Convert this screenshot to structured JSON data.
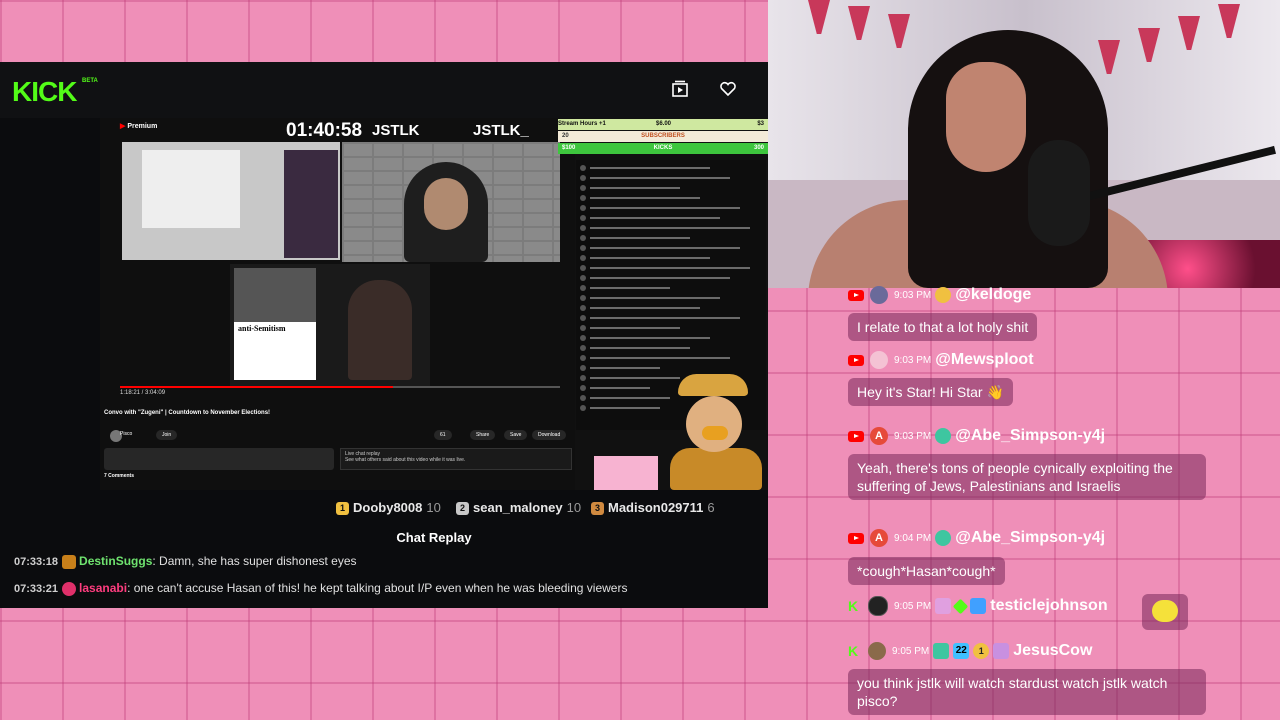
{
  "kick": {
    "logo": "KICK",
    "beta": "BETA",
    "theater_icon": "theater-mode-icon",
    "follow_icon": "heart-icon"
  },
  "embedded_video": {
    "yt_logo": "Premium",
    "timer": "01:40:58",
    "tag1": "JSTLK",
    "tag2": "JSTLK_",
    "anti_title": "anti-Semitism",
    "controls_time": "1:18:21 / 3:04:09",
    "title": "Convo with \"Zugeni\" | Countdown to November Elections!",
    "channel_name": "Pisco",
    "pills": [
      "Join",
      "61",
      "Share",
      "Save",
      "Download"
    ],
    "live_chat": "Live chat replay",
    "live_chat_sub": "See what others said about this video while it was live.",
    "comments": "7 Comments",
    "stat_stream_hours": "Stream Hours",
    "stat_plus": "+1",
    "stat_money": "$6.00",
    "stat_subs": "SUBSCRIBERS",
    "stat_kicks": "KICKS",
    "stat_left": "$100",
    "stat_right": "300",
    "stat_20": "20",
    "stat_30": "$3"
  },
  "leaderboard": [
    {
      "rank": "1",
      "name": "Dooby8008",
      "count": "10",
      "color": "#f0c040"
    },
    {
      "rank": "2",
      "name": "sean_maloney",
      "count": "10",
      "color": "#c8c8c8"
    },
    {
      "rank": "3",
      "name": "Madison029711",
      "count": "6",
      "color": "#d08a40"
    }
  ],
  "chat_replay": {
    "title": "Chat Replay",
    "messages": [
      {
        "time": "07:33:18",
        "user": "DestinSuggs",
        "user_color": "#6fe36f",
        "text": ": Damn, she has super dishonest eyes",
        "badge_color": "#c8801a"
      },
      {
        "time": "07:33:21",
        "user": "lasanabi",
        "user_color": "#ff3d7f",
        "text": ": one can't accuse Hasan of this! he kept talking about I/P even when he was bleeding viewers",
        "badge_color": "#e0306a"
      }
    ]
  },
  "right_chat": {
    "messages": [
      {
        "platform": "youtube",
        "time": "9:03 PM",
        "user": "@keldoge",
        "text": "I relate to that a lot holy shit",
        "avatar_color": "#6a6a9a",
        "avatar_letter": ""
      },
      {
        "platform": "youtube",
        "time": "9:03 PM",
        "user": "@Mewsploot",
        "text": "Hey it's Star! Hi Star 👋",
        "avatar_color": "#f4c2d4",
        "avatar_letter": ""
      },
      {
        "platform": "youtube",
        "time": "9:03 PM",
        "user": "@Abe_Simpson-y4j",
        "text": "Yeah, there's tons of people cynically exploiting the suffering of Jews, Palestinians and Israelis",
        "avatar_color": "#e64a3a",
        "avatar_letter": "A"
      },
      {
        "platform": "youtube",
        "time": "9:04 PM",
        "user": "@Abe_Simpson-y4j",
        "text": "*cough*Hasan*cough*",
        "avatar_color": "#e64a3a",
        "avatar_letter": "A"
      },
      {
        "platform": "kick",
        "time": "9:05 PM",
        "user": "testiclejohnson",
        "text": "",
        "avatar_color": "#222222",
        "avatar_letter": ""
      },
      {
        "platform": "kick",
        "time": "9:05 PM",
        "user": "JesusCow",
        "text": "you think jstlk will watch stardust watch jstlk watch pisco?",
        "avatar_color": "#8a6a4a",
        "avatar_letter": "",
        "badge_num": "22"
      }
    ]
  },
  "colors": {
    "kick_green": "#53fc18",
    "background_pink": "#ef8fb8",
    "bubble": "#78285a"
  }
}
